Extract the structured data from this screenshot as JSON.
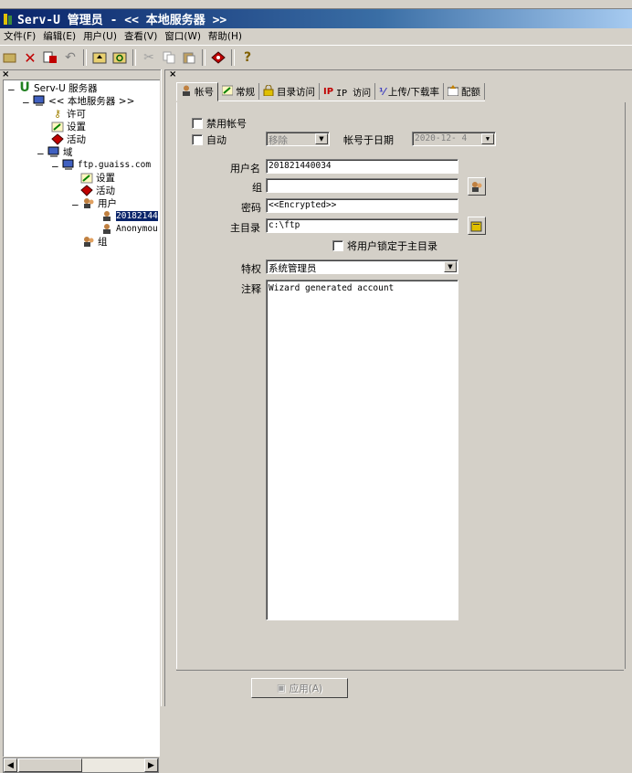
{
  "window": {
    "title": "Serv-U 管理员 - << 本地服务器 >>"
  },
  "menu": [
    "文件(F)",
    "编辑(E)",
    "用户(U)",
    "查看(V)",
    "窗口(W)",
    "帮助(H)"
  ],
  "toolbar": {
    "icons": [
      "open-icon",
      "delete-icon",
      "properties-icon",
      "undo-icon",
      "up-icon",
      "refresh-icon",
      "cut-icon",
      "copy-icon",
      "paste-icon",
      "wizard-icon",
      "help-icon"
    ]
  },
  "tree": {
    "root": "Serv-U 服务器",
    "local_server": "<< 本地服务器 >>",
    "license": "许可",
    "settings": "设置",
    "activity": "活动",
    "domains": "域",
    "domain_name": "ftp.guaiss.com",
    "domain_settings": "设置",
    "domain_activity": "活动",
    "users": "用户",
    "user1": "20182144",
    "user2": "Anonymou",
    "groups": "组"
  },
  "tabs": [
    "帐号",
    "常规",
    "目录访问",
    "IP 访问",
    "上传/下载率",
    "配额"
  ],
  "account": {
    "disable_label": "禁用帐号",
    "auto_label": "自动",
    "auto_action": "移除",
    "expire_label": "帐号于日期",
    "expire_date": "2020-12- 4",
    "username_label": "用户名",
    "username_value": "201821440034",
    "group_label": "组",
    "group_value": "",
    "password_label": "密码",
    "password_value": "<<Encrypted>>",
    "home_label": "主目录",
    "home_value": "c:\\ftp",
    "lock_label": "将用户锁定于主目录",
    "privilege_label": "特权",
    "privilege_value": "系统管理员",
    "notes_label": "注释",
    "notes_value": "Wizard generated account"
  },
  "apply_button": "应用(A)",
  "colors": {
    "titlebar": "#0a246a",
    "face": "#d4d0c8",
    "selection": "#0a246a"
  }
}
